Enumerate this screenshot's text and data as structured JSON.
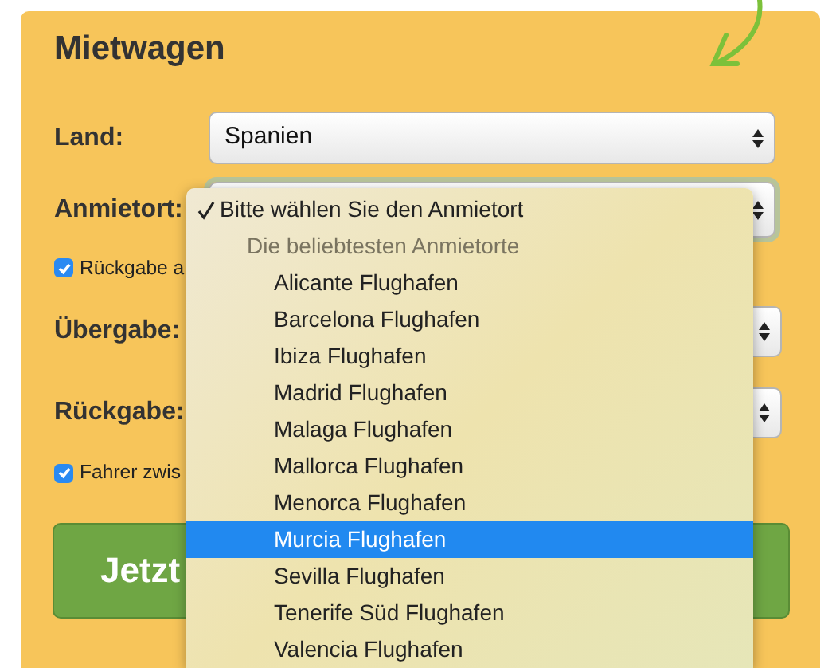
{
  "title": "Mietwagen",
  "fields": [
    {
      "kind": "select",
      "label": "Land:",
      "value": "Spanien"
    },
    {
      "kind": "select",
      "label": "Anmietort:"
    },
    {
      "kind": "checkbox",
      "label": "Rückgabe a",
      "checked": true
    },
    {
      "kind": "select",
      "label": "Übergabe:"
    },
    {
      "kind": "select",
      "label": "Rückgabe:"
    },
    {
      "kind": "checkbox",
      "label": "Fahrer zwis",
      "checked": true
    }
  ],
  "button": "Jetzt",
  "dropdown": {
    "options": [
      {
        "kind": "option",
        "label": "Bitte wählen Sie den Anmietort",
        "checked": true,
        "selected": false
      },
      {
        "kind": "group",
        "label": "Die beliebtesten Anmietorte"
      },
      {
        "kind": "option",
        "label": "Alicante Flughafen",
        "checked": false,
        "selected": false
      },
      {
        "kind": "option",
        "label": "Barcelona Flughafen",
        "checked": false,
        "selected": false
      },
      {
        "kind": "option",
        "label": "Ibiza Flughafen",
        "checked": false,
        "selected": false
      },
      {
        "kind": "option",
        "label": "Madrid Flughafen",
        "checked": false,
        "selected": false
      },
      {
        "kind": "option",
        "label": "Malaga Flughafen",
        "checked": false,
        "selected": false
      },
      {
        "kind": "option",
        "label": "Mallorca Flughafen",
        "checked": false,
        "selected": false
      },
      {
        "kind": "option",
        "label": "Menorca Flughafen",
        "checked": false,
        "selected": false
      },
      {
        "kind": "option",
        "label": "Murcia Flughafen",
        "checked": false,
        "selected": true
      },
      {
        "kind": "option",
        "label": "Sevilla Flughafen",
        "checked": false,
        "selected": false
      },
      {
        "kind": "option",
        "label": "Tenerife Süd Flughafen",
        "checked": false,
        "selected": false
      },
      {
        "kind": "option",
        "label": "Valencia Flughafen",
        "checked": false,
        "selected": false
      }
    ]
  }
}
